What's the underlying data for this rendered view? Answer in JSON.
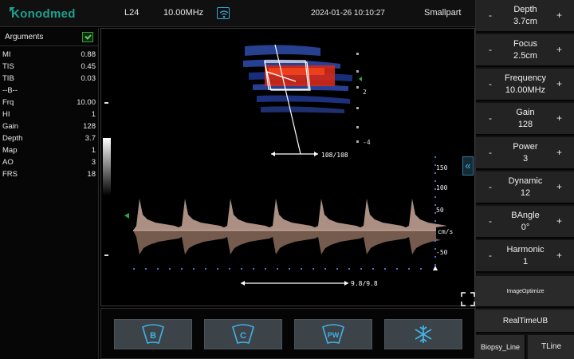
{
  "topbar": {
    "logo": "Konodmed",
    "probe": "L24",
    "frequency": "10.00MHz",
    "wifi_icon": "wifi-icon",
    "datetime": "2024-01-26 10:10:27",
    "preset": "Smallpart"
  },
  "arguments": {
    "title": "Arguments",
    "rows": [
      {
        "label": "MI",
        "value": "0.88"
      },
      {
        "label": "TIS",
        "value": "0.45"
      },
      {
        "label": "TIB",
        "value": "0.03"
      },
      {
        "label": "--B--",
        "value": ""
      },
      {
        "label": "Frq",
        "value": "10.00"
      },
      {
        "label": "HI",
        "value": "1"
      },
      {
        "label": "Gain",
        "value": "128"
      },
      {
        "label": "Depth",
        "value": "3.7"
      },
      {
        "label": "Map",
        "value": "1"
      },
      {
        "label": "AO",
        "value": "3"
      },
      {
        "label": "FRS",
        "value": "18"
      }
    ]
  },
  "image": {
    "color_box_scale": [
      "2",
      "-4"
    ],
    "gate_readout": "108/108",
    "doppler_scale": [
      "150",
      "100",
      "50",
      "cm/s",
      "-50"
    ],
    "baseline_readout": "9.8/9.8"
  },
  "modes": [
    {
      "label": "B",
      "icon": "b-mode-icon"
    },
    {
      "label": "C",
      "icon": "color-mode-icon"
    },
    {
      "label": "PW",
      "icon": "pw-mode-icon"
    },
    {
      "label": "",
      "icon": "freeze-snowflake-icon"
    }
  ],
  "params": [
    {
      "label": "Depth",
      "value": "3.7cm"
    },
    {
      "label": "Focus",
      "value": "2.5cm"
    },
    {
      "label": "Frequency",
      "value": "10.00MHz"
    },
    {
      "label": "Gain",
      "value": "128"
    },
    {
      "label": "Power",
      "value": "3"
    },
    {
      "label": "Dynamic",
      "value": "12"
    },
    {
      "label": "BAngle",
      "value": "0°"
    },
    {
      "label": "Harmonic",
      "value": "1"
    }
  ],
  "controls": {
    "minus": "-",
    "plus": "+",
    "image_optimize": "ImageOptimize",
    "realtime": "RealTimeUB",
    "biopsy": "Biopsy_Line",
    "tline": "TLine",
    "collapse": "«"
  },
  "colors": {
    "accent": "#40b2e6",
    "brand": "#1fa18e",
    "flow_red": "#d42a1a",
    "flow_blue": "#2f4fd0"
  }
}
